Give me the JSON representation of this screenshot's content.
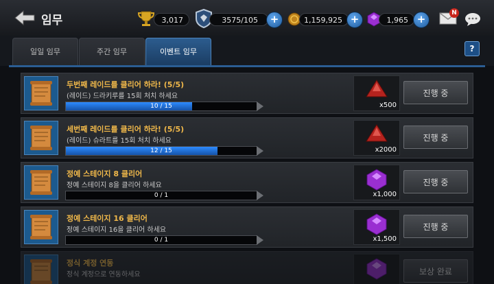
{
  "header": {
    "title": "임무",
    "trophy_value": "3,017",
    "stamina_value": "3575/105",
    "gold_value": "1,159,925",
    "gem_value": "1,965",
    "mail_badge": "N"
  },
  "tabs": [
    {
      "label": "일일 임무"
    },
    {
      "label": "주간 임무"
    },
    {
      "label": "이벤트 임무"
    }
  ],
  "help_label": "?",
  "colors": {
    "accent": "#2b5d93",
    "title_gold": "#f0b84a",
    "bar_blue": "#2d8bff"
  },
  "missions": [
    {
      "title": "두번째 레이드를 클리어 하라! (5/5)",
      "desc": "(레이드) 드라키루를 15회 처치 하세요",
      "progress_text": "10 / 15",
      "progress": 0.6667,
      "reward_icon": "red-ore-icon",
      "reward_qty": "x500",
      "status": "진행 중"
    },
    {
      "title": "세번째 레이드를 클리어 하라! (5/5)",
      "desc": "(레이드) 슈라트를 15회 처치 하세요",
      "progress_text": "12 / 15",
      "progress": 0.8,
      "reward_icon": "red-ore-icon",
      "reward_qty": "x2000",
      "status": "진행 중"
    },
    {
      "title": "정예 스테이지 8 클리어",
      "desc": "정예 스테이지 8을 클리어 하세요",
      "progress_text": "0 / 1",
      "progress": 0,
      "reward_icon": "purple-gem-icon",
      "reward_qty": "x1,000",
      "status": "진행 중"
    },
    {
      "title": "정예 스테이지 16 클리어",
      "desc": "정예 스테이지 16을 클리어 하세요",
      "progress_text": "0 / 1",
      "progress": 0,
      "reward_icon": "purple-gem-icon",
      "reward_qty": "x1,500",
      "status": "진행 중"
    },
    {
      "title": "정식 계정 연동",
      "desc": "정식 계정으로 연동하세요",
      "progress_text": "",
      "progress": 0,
      "reward_icon": "purple-gem-icon",
      "reward_qty": "",
      "status": "보상 완료"
    }
  ]
}
